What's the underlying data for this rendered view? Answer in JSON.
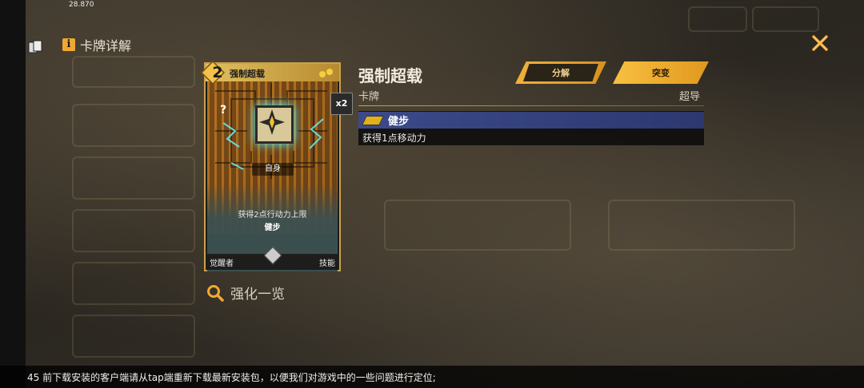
{
  "status": {
    "fps": "28.870"
  },
  "header": {
    "title": "卡牌详解"
  },
  "card": {
    "cost": "2",
    "name": "强制超载",
    "multiplier": "x2",
    "unknown_mark": "?",
    "target": "自身",
    "description_line1": "获得2点行动力上限",
    "description_line2": "健步",
    "footer_left": "觉醒者",
    "footer_right": "技能"
  },
  "enhance": {
    "label": "强化一览"
  },
  "detail": {
    "title": "强制超载",
    "type": "卡牌",
    "rarity": "超导",
    "buttons": {
      "dismantle": "分解",
      "breakthrough": "突变"
    },
    "keyword": {
      "name": "健步",
      "description": "获得1点移动力"
    }
  },
  "footer_message": "45 前下载安装的客户端请从tap端重新下载最新安装包，以便我们对游戏中的一些问题进行定位;",
  "colors": {
    "accent": "#f0a832",
    "keyword_bar": "#3b4a8a",
    "card_border": "#c9a24a"
  }
}
